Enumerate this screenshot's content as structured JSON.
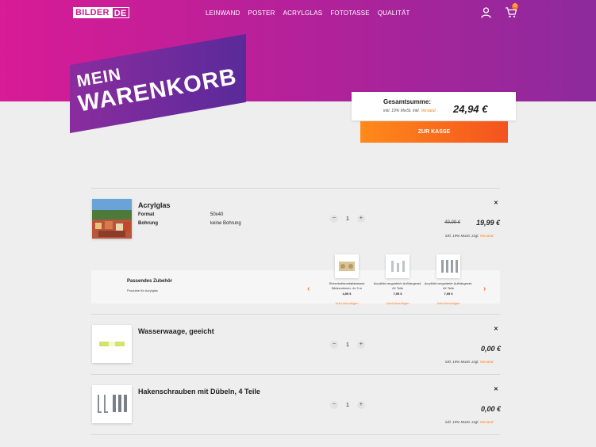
{
  "header": {
    "logo_left": "BILDER",
    "logo_right": "DE",
    "nav": [
      "LEINWAND",
      "POSTER",
      "ACRYLGLAS",
      "FOTOTASSE",
      "QUALITÄT"
    ],
    "cart_count": "0"
  },
  "title": {
    "line1": "MEIN",
    "line2": "WARENKORB"
  },
  "summary": {
    "label": "Gesamtsumme:",
    "note_prefix": "inkl. 19% MwSt. inkl.",
    "note_link": "Versand",
    "total": "24,94 €",
    "checkout": "ZUR KASSE"
  },
  "items": [
    {
      "name": "Acrylglas",
      "attrs": [
        {
          "label": "Format",
          "value": "50x40"
        },
        {
          "label": "Bohrung",
          "value": "keine Bohrung"
        }
      ],
      "qty": "1",
      "old_price": "49,99 €",
      "price": "19,99 €",
      "vat_prefix": "inkl. 19% MwSt. zzgl.",
      "vat_link": "Versand"
    },
    {
      "name": "Wasserwaage, geeicht",
      "qty": "1",
      "price": "0,00 €",
      "vat_prefix": "inkl. 19% MwSt. zzgl.",
      "vat_link": "Versand"
    },
    {
      "name": "Hakenschrauben mit Dübeln, 4 Teile",
      "qty": "1",
      "price": "0,00 €",
      "vat_prefix": "inkl. 19% MwSt. zzgl.",
      "vat_link": "Versand"
    }
  ],
  "accessories": {
    "title": "Passendes Zubehör",
    "subtitle": "Produkte für Acrylglas",
    "add_label": "Jetzt hinzufügen",
    "list": [
      {
        "name": "Sicherheitsmetallabstand Bilderrahmen, 4x 3 m",
        "price": "4,95 €"
      },
      {
        "name": "Acrylblid vergoldet/e Aufhängeset, 4X Teile",
        "price": "7,95 €"
      },
      {
        "name": "Acrylblid vergoldet/e Aufhängeset, 4X Teile",
        "price": "7,95 €"
      }
    ]
  },
  "icons": {
    "user": "user-icon",
    "cart": "cart-icon",
    "remove": "close-icon",
    "prev": "chevron-left-icon",
    "next": "chevron-right-icon"
  },
  "colors": {
    "brand": "#d81b96",
    "accent": "#ff7a1a",
    "title_banner": "#6a2a9c"
  }
}
